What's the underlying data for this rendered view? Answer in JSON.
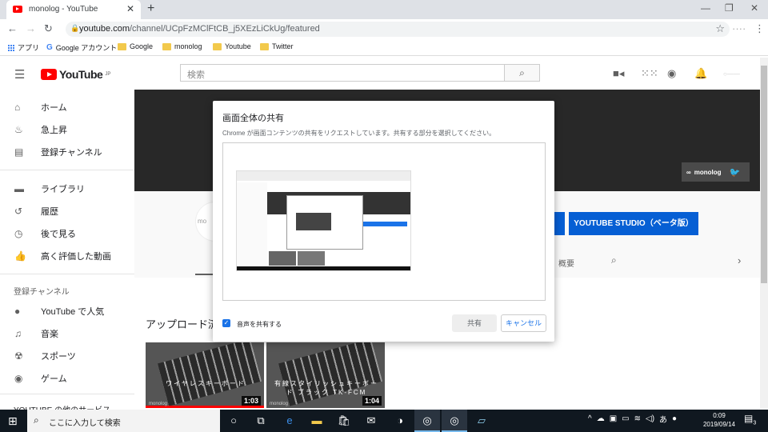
{
  "browser": {
    "tab_title": "monolog - YouTube",
    "tab_close": "✕",
    "new_tab": "+",
    "window_min": "—",
    "window_max": "❐",
    "window_close": "✕",
    "url_host": "youtube.com",
    "url_path": "/channel/UCpFzMClFtCB_j5XEzLiCkUg/featured",
    "bookmarks": [
      "アプリ",
      "Google アカウント",
      "Google",
      "monolog",
      "Youtube",
      "Twitter"
    ]
  },
  "youtube": {
    "logo_text": "YouTube",
    "logo_region": "JP",
    "search_placeholder": "検索",
    "sidebar": {
      "main": [
        "ホーム",
        "急上昇",
        "登録チャンネル"
      ],
      "library": [
        "ライブラリ",
        "履歴",
        "後で見る",
        "高く評価した動画"
      ],
      "subs_header": "登録チャンネル",
      "subs": [
        "YouTube で人気",
        "音楽",
        "スポーツ",
        "ゲーム"
      ],
      "more_header": "YOUTUBE の他のサービス"
    },
    "channel_badge": "monolog",
    "avatar_text": "mo",
    "studio_button": "YOUTUBE STUDIO（ベータ版）",
    "tab_about": "概要",
    "uploads_heading": "アップロード済み",
    "videos": [
      {
        "title": "ワイヤレスキーボード",
        "duration": "1:03",
        "watermark": "monolog"
      },
      {
        "title": "有線スタイリッシュキーボード ブラック TK-FCM",
        "duration": "1:04",
        "watermark": "monolog"
      }
    ]
  },
  "dialog": {
    "title": "画面全体の共有",
    "subtitle": "Chrome が画面コンテンツの共有をリクエストしています。共有する部分を選択してください。",
    "audio_checkbox_label": "音声を共有する",
    "audio_checked": true,
    "share_button": "共有",
    "cancel_button": "キャンセル"
  },
  "taskbar": {
    "search_placeholder": "ここに入力して検索",
    "time": "0:09",
    "date": "2019/09/14",
    "ime": "あ",
    "notification_count": "3"
  }
}
